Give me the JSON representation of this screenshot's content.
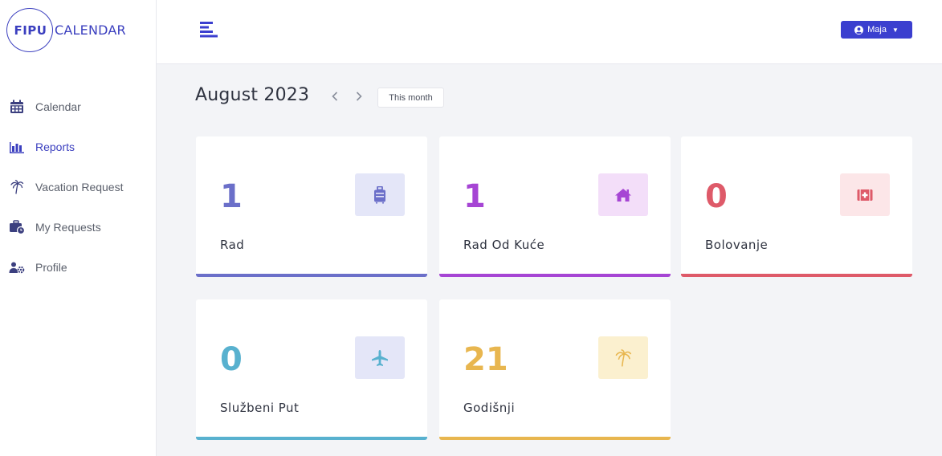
{
  "brand": {
    "fipu": "FIPU",
    "calendar": "CALENDAR"
  },
  "sidebar": {
    "items": [
      {
        "label": "Calendar",
        "icon": "calendar-icon"
      },
      {
        "label": "Reports",
        "icon": "bar-chart-icon",
        "active": true
      },
      {
        "label": "Vacation Request",
        "icon": "palm-tree-icon"
      },
      {
        "label": "My Requests",
        "icon": "briefcase-clock-icon"
      },
      {
        "label": "Profile",
        "icon": "users-cog-icon"
      }
    ]
  },
  "topbar": {
    "user_label": "Maja",
    "menu_icon": "hamburger-icon"
  },
  "header": {
    "month": "August 2023",
    "this_month": "This month"
  },
  "cards": [
    {
      "count": "1",
      "label": "Rad",
      "icon": "suitcase-icon",
      "color": "#6b6fc9",
      "bg": "#e4e6f8"
    },
    {
      "count": "1",
      "label": "Rad Od Kuće",
      "icon": "home-icon",
      "color": "#a645d4",
      "bg": "#f3def9"
    },
    {
      "count": "0",
      "label": "Bolovanje",
      "icon": "medical-kit-icon",
      "color": "#de5a69",
      "bg": "#fce6e8"
    },
    {
      "count": "0",
      "label": "Službeni Put",
      "icon": "airplane-icon",
      "color": "#58b1cf",
      "bg": "#e4e6f8"
    },
    {
      "count": "21",
      "label": "Godišnji",
      "icon": "palm-tree-icon",
      "color": "#e8b64f",
      "bg": "#fbf0cf"
    }
  ],
  "colors": {
    "accent": "#3b3fcf",
    "background": "#f3f4f7"
  }
}
